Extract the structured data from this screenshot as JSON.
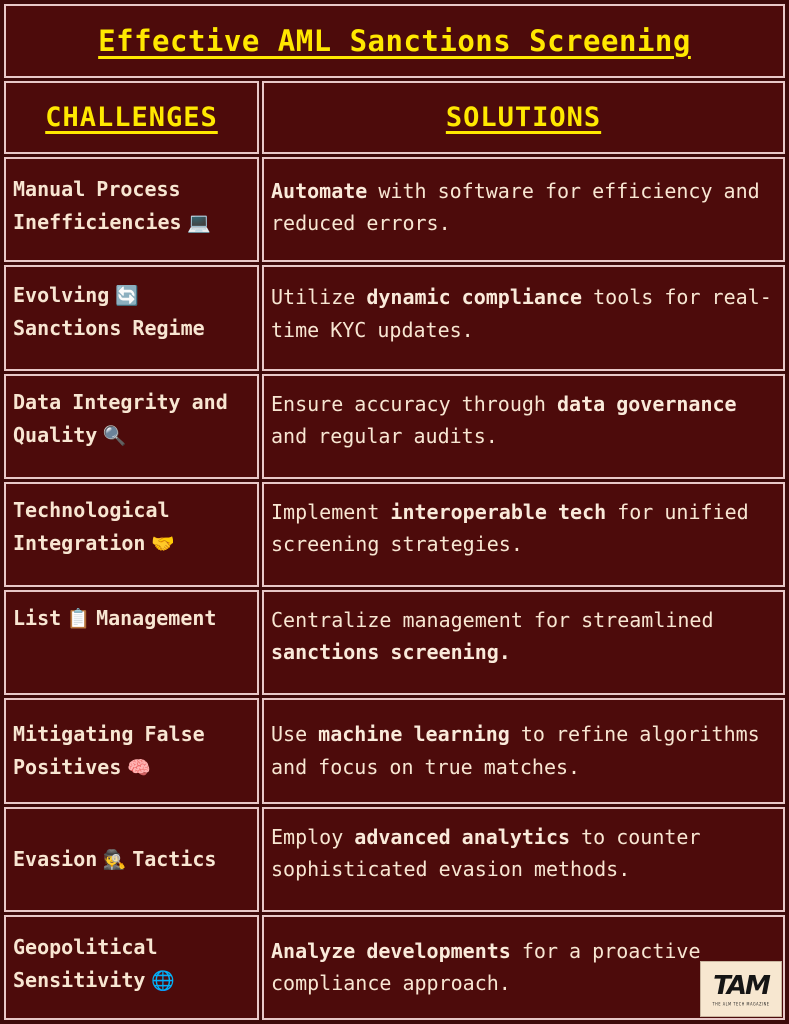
{
  "theme": {
    "background": "#3d0a0a",
    "cell_background": "#4d0b0b",
    "border": "#e8c8c8",
    "accent_yellow": "#ffe800",
    "body_text": "#f8e6d2"
  },
  "title": "Effective AML Sanctions Screening",
  "headers": {
    "challenges": "CHALLENGES",
    "solutions": "SOLUTIONS"
  },
  "rows": [
    {
      "challenge_text": "Manual Process Inefficiencies",
      "challenge_icon": "laptop-icon",
      "challenge_icon_glyph": "💻",
      "solution_parts": [
        {
          "text": "Automate",
          "bold": true
        },
        {
          "text": " with software for efficiency and reduced errors.",
          "bold": false
        }
      ]
    },
    {
      "challenge_text": "Evolving Sanctions Regime",
      "challenge_icon": "refresh-cycle-icon",
      "challenge_icon_glyph": "🔄",
      "icon_after_word": 1,
      "solution_parts": [
        {
          "text": "Utilize ",
          "bold": false
        },
        {
          "text": "dynamic compliance",
          "bold": true
        },
        {
          "text": " tools for real-time KYC updates.",
          "bold": false
        }
      ]
    },
    {
      "challenge_text": "Data Integrity and Quality",
      "challenge_icon": "magnifying-glass-icon",
      "challenge_icon_glyph": "🔍",
      "solution_parts": [
        {
          "text": "Ensure accuracy through ",
          "bold": false
        },
        {
          "text": "data governance",
          "bold": true
        },
        {
          "text": " and regular audits.",
          "bold": false
        }
      ]
    },
    {
      "challenge_text": "Technological Integration",
      "challenge_icon": "handshake-icon",
      "challenge_icon_glyph": "🤝",
      "solution_parts": [
        {
          "text": "Implement ",
          "bold": false
        },
        {
          "text": "interoperable tech",
          "bold": true
        },
        {
          "text": " for unified screening strategies.",
          "bold": false
        }
      ]
    },
    {
      "challenge_text": "List Management",
      "challenge_icon": "clipboard-icon",
      "challenge_icon_glyph": "📋",
      "icon_after_word": 1,
      "solution_parts": [
        {
          "text": "Centralize management for streamlined ",
          "bold": false
        },
        {
          "text": "sanctions screening.",
          "bold": true
        }
      ]
    },
    {
      "challenge_text": "Mitigating False Positives",
      "challenge_icon": "brain-icon",
      "challenge_icon_glyph": "🧠",
      "solution_parts": [
        {
          "text": "Use ",
          "bold": false
        },
        {
          "text": "machine learning",
          "bold": true
        },
        {
          "text": " to refine algorithms and focus on true matches.",
          "bold": false
        }
      ]
    },
    {
      "challenge_text": "Evasion Tactics",
      "challenge_icon": "detective-icon",
      "challenge_icon_glyph": "🕵️",
      "icon_after_word": 1,
      "solution_parts": [
        {
          "text": "Employ ",
          "bold": false
        },
        {
          "text": "advanced analytics",
          "bold": true
        },
        {
          "text": " to counter sophisticated evasion methods.",
          "bold": false
        }
      ]
    },
    {
      "challenge_text": "Geopolitical Sensitivity",
      "challenge_icon": "globe-icon",
      "challenge_icon_glyph": "🌐",
      "solution_parts": [
        {
          "text": "Analyze developments",
          "bold": true
        },
        {
          "text": " for a proactive compliance approach.",
          "bold": false
        }
      ]
    }
  ],
  "logo": {
    "mark": "TAM",
    "tagline": "THE ALM TECH MAGAZINE"
  }
}
